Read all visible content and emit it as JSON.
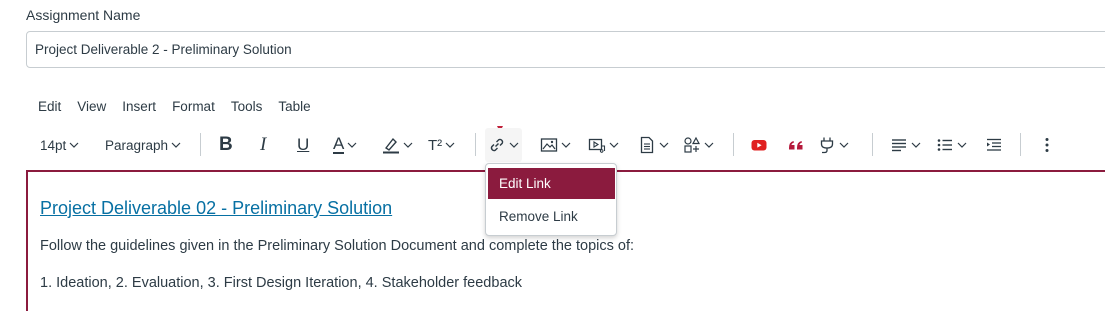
{
  "assignment": {
    "label": "Assignment Name",
    "value": "Project Deliverable 2 - Preliminary Solution"
  },
  "menubar": [
    "Edit",
    "View",
    "Insert",
    "Format",
    "Tools",
    "Table"
  ],
  "toolbar": {
    "font_size": "14pt",
    "block_format": "Paragraph",
    "bold": "B",
    "italic": "I",
    "underline": "U",
    "text_color": "A",
    "superscript": "T²",
    "icons": [
      "bold-icon",
      "italic-icon",
      "underline-icon",
      "text-color-icon",
      "highlight-icon",
      "superscript-icon",
      "link-icon",
      "image-icon",
      "media-icon",
      "document-icon",
      "apps-icon",
      "youtube-icon",
      "quote-icon",
      "plugin-icon",
      "align-icon",
      "bullet-list-icon",
      "indent-icon",
      "more-icon"
    ],
    "colors": {
      "accent": "#8b1b3e",
      "youtube": "#e02020",
      "quote": "#b5193b",
      "link": "#0770a3"
    }
  },
  "link_menu": {
    "edit_label": "Edit Link",
    "remove_label": "Remove Link"
  },
  "document": {
    "heading_link": "Project Deliverable 02 - Preliminary Solution",
    "paragraph1": "Follow the guidelines given in the Preliminary Solution Document and complete the topics of:",
    "paragraph2": "1. Ideation, 2. Evaluation, 3. First Design Iteration, 4. Stakeholder feedback"
  }
}
